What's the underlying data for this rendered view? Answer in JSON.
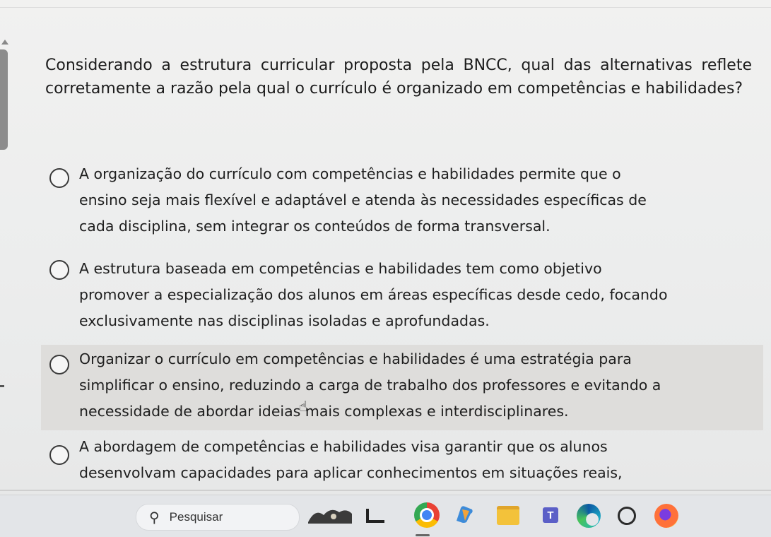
{
  "question": {
    "text": "Considerando a estrutura curricular proposta pela BNCC, qual das alternativas reflete corretamente a razão pela qual o currículo é organizado em competências e habilidades?"
  },
  "options": [
    {
      "lines": [
        "A organização do currículo com competências e habilidades permite que o",
        "ensino seja mais flexível e adaptável e atenda às necessidades específicas de",
        "cada disciplina, sem integrar os conteúdos de forma transversal."
      ]
    },
    {
      "lines": [
        "A estrutura baseada em competências e habilidades tem como objetivo",
        "promover a especialização dos alunos em áreas específicas desde cedo, focando",
        "exclusivamente nas disciplinas isoladas e aprofundadas."
      ]
    },
    {
      "lines": [
        "Organizar o currículo em competências e habilidades é uma estratégia para",
        "simplificar o ensino, reduzindo a carga de trabalho dos professores e evitando a",
        "necessidade de abordar ideias mais complexas e interdisciplinares."
      ]
    },
    {
      "lines": [
        "A abordagem de competências e habilidades visa garantir que os alunos",
        "desenvolvam capacidades para aplicar conhecimentos em situações reais,"
      ]
    }
  ],
  "taskbar": {
    "search_placeholder": "Pesquisar",
    "icons": [
      "windows-start-icon",
      "search-icon",
      "widgets-icon",
      "tv-icon",
      "chrome-icon",
      "copilot-icon",
      "file-explorer-icon",
      "teams-icon",
      "edge-icon",
      "whatsapp-icon",
      "firefox-icon"
    ]
  },
  "colors": {
    "hover_row": "#dedddb",
    "windows_blue": "#1e88e5",
    "folder_yellow": "#f3c23a",
    "teams_purple": "#5b5fc7"
  }
}
